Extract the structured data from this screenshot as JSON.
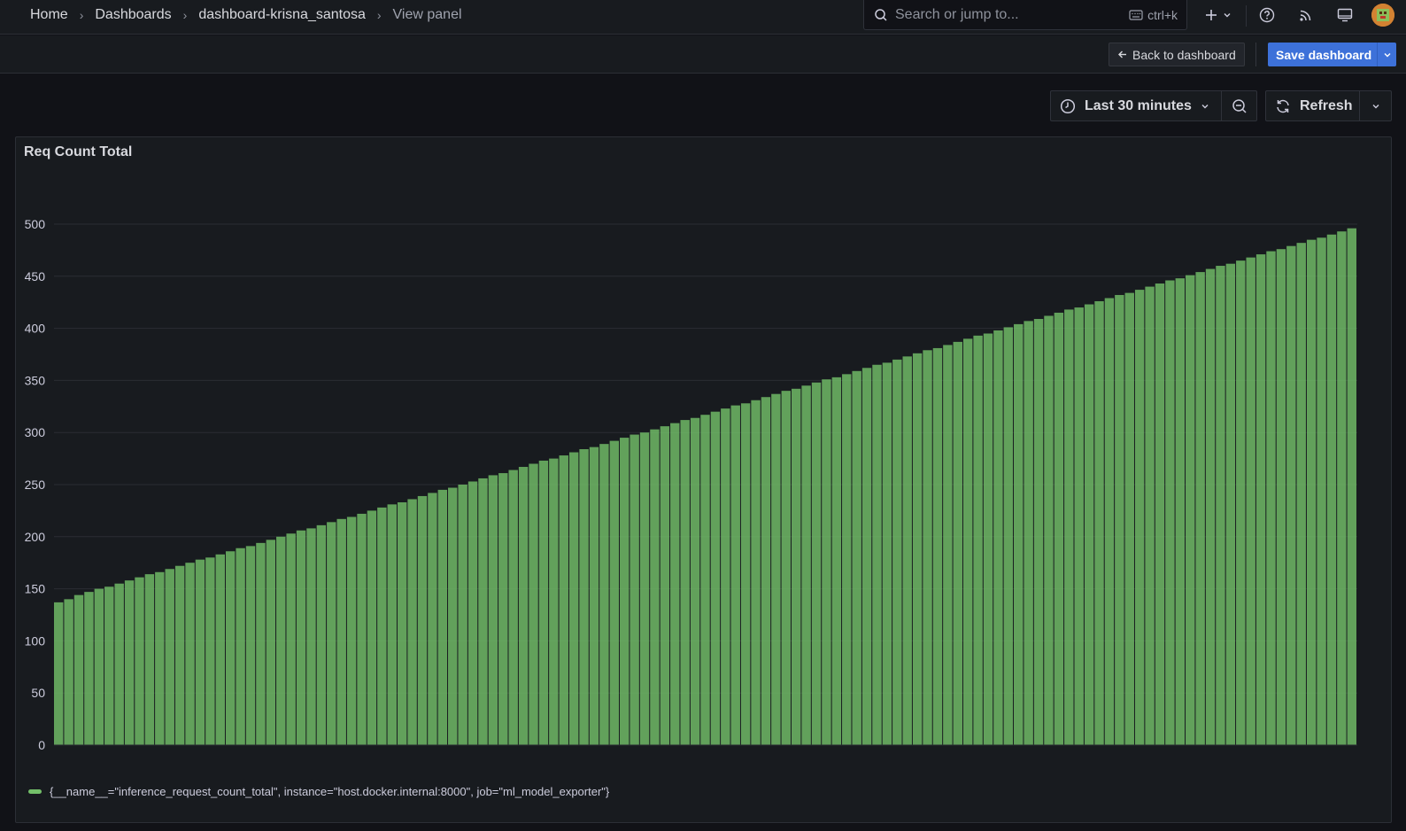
{
  "nav": {
    "breadcrumbs": [
      "Home",
      "Dashboards",
      "dashboard-krisna_santosa",
      "View panel"
    ],
    "search_placeholder": "Search or jump to...",
    "search_shortcut": "ctrl+k",
    "icons": [
      "plus-icon",
      "chevron-down-icon",
      "help-icon",
      "rss-icon",
      "monitor-icon",
      "avatar"
    ]
  },
  "toolbar": {
    "back_label": "Back to dashboard",
    "save_label": "Save dashboard"
  },
  "time": {
    "range_label": "Last 30 minutes",
    "refresh_label": "Refresh"
  },
  "panel": {
    "title": "Req Count Total",
    "legend": "{__name__=\"inference_request_count_total\", instance=\"host.docker.internal:8000\", job=\"ml_model_exporter\"}"
  },
  "chart_data": {
    "type": "bar",
    "title": "Req Count Total",
    "xlabel": "",
    "ylabel": "",
    "ylim": [
      0,
      500
    ],
    "yticks": [
      0,
      50,
      100,
      150,
      200,
      250,
      300,
      350,
      400,
      450,
      500
    ],
    "grid": true,
    "legend_position": "bottom",
    "series": [
      {
        "name": "{__name__=\"inference_request_count_total\", instance=\"host.docker.internal:8000\", job=\"ml_model_exporter\"}",
        "color": "#73bf69",
        "values": [
          137,
          140,
          144,
          147,
          150,
          152,
          155,
          158,
          161,
          164,
          166,
          169,
          172,
          175,
          178,
          180,
          183,
          186,
          189,
          191,
          194,
          197,
          200,
          203,
          206,
          208,
          211,
          214,
          217,
          219,
          222,
          225,
          228,
          231,
          233,
          236,
          239,
          242,
          245,
          247,
          250,
          253,
          256,
          259,
          261,
          264,
          267,
          270,
          273,
          275,
          278,
          281,
          284,
          286,
          289,
          292,
          295,
          298,
          300,
          303,
          306,
          309,
          312,
          314,
          317,
          320,
          323,
          326,
          328,
          331,
          334,
          337,
          340,
          342,
          345,
          348,
          351,
          353,
          356,
          359,
          362,
          365,
          367,
          370,
          373,
          376,
          379,
          381,
          384,
          387,
          390,
          393,
          395,
          398,
          401,
          404,
          407,
          409,
          412,
          415,
          418,
          420,
          423,
          426,
          429,
          432,
          434,
          437,
          440,
          443,
          446,
          448,
          451,
          454,
          457,
          460,
          462,
          465,
          468,
          471,
          474,
          476,
          479,
          482,
          485,
          487,
          490,
          493,
          496
        ]
      }
    ]
  },
  "colors": {
    "background": "#111217",
    "panel": "#181b1f",
    "accent": "#3d71d9",
    "series": "#73bf69"
  }
}
